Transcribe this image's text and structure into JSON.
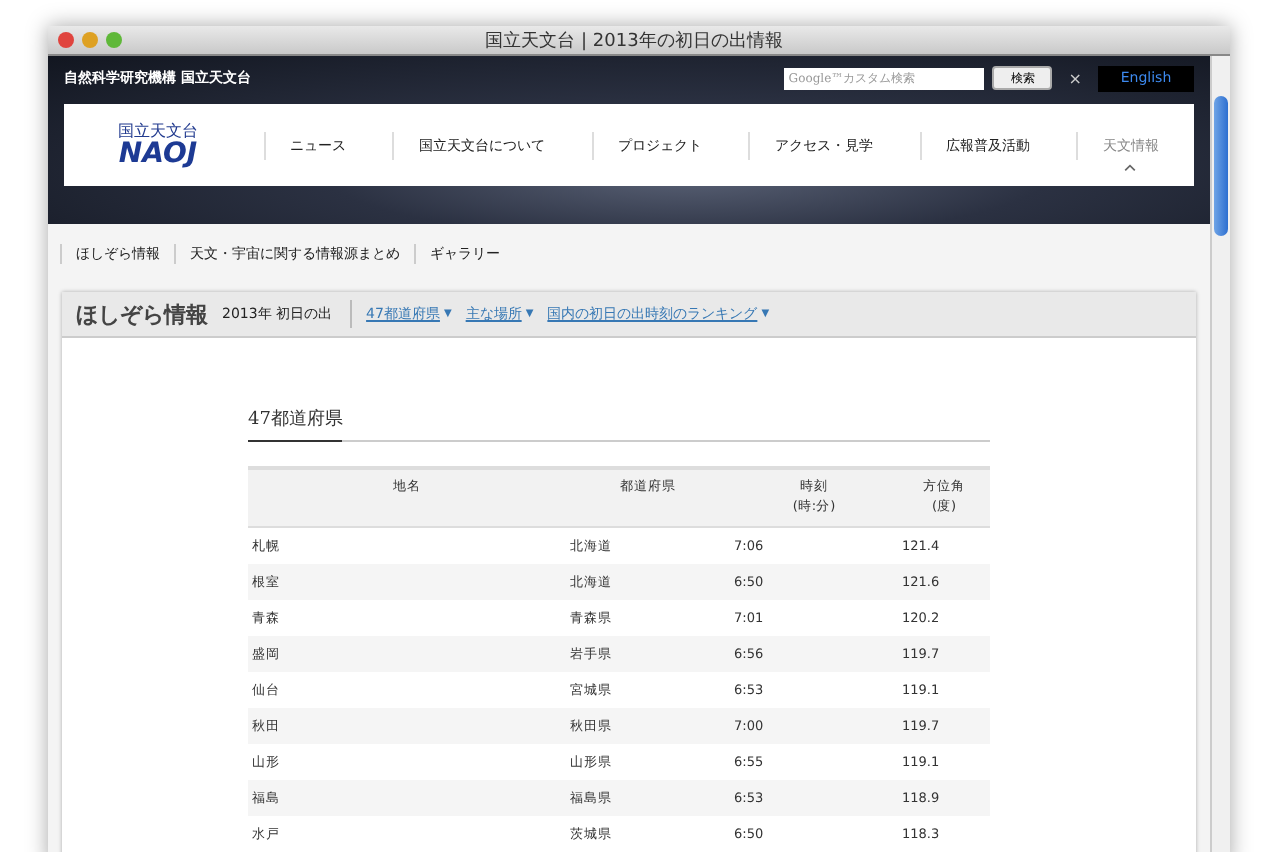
{
  "window": {
    "title": "国立天文台 | 2013年の初日の出情報"
  },
  "header": {
    "org": "自然科学研究機構 国立天文台",
    "search_placeholder": "カスタム検索",
    "search_brand": "Google™",
    "search_button": "検索",
    "clear": "×",
    "english": "English"
  },
  "logo": {
    "caption": "国立天文台",
    "text": "NAOJ"
  },
  "nav": [
    {
      "label": "ニュース",
      "selected": false
    },
    {
      "label": "国立天文台について",
      "selected": false
    },
    {
      "label": "プロジェクト",
      "selected": false
    },
    {
      "label": "アクセス・見学",
      "selected": false
    },
    {
      "label": "広報普及活動",
      "selected": false
    },
    {
      "label": "天文情報",
      "selected": true
    }
  ],
  "subnav": [
    "ほしぞら情報",
    "天文・宇宙に関する情報源まとめ",
    "ギャラリー"
  ],
  "section": {
    "title": "ほしぞら情報",
    "subtitle": "2013年 初日の出",
    "links": [
      "47都道府県",
      "主な場所",
      "国内の初日の出時刻のランキング"
    ],
    "caret": "▼"
  },
  "content": {
    "heading": "47都道府県",
    "table": {
      "columns": [
        "地名",
        "都道府県",
        "時刻\n(時:分)",
        "方位角\n(度)"
      ],
      "rows": [
        [
          "札幌",
          "北海道",
          "7:06",
          "121.4"
        ],
        [
          "根室",
          "北海道",
          "6:50",
          "121.6"
        ],
        [
          "青森",
          "青森県",
          "7:01",
          "120.2"
        ],
        [
          "盛岡",
          "岩手県",
          "6:56",
          "119.7"
        ],
        [
          "仙台",
          "宮城県",
          "6:53",
          "119.1"
        ],
        [
          "秋田",
          "秋田県",
          "7:00",
          "119.7"
        ],
        [
          "山形",
          "山形県",
          "6:55",
          "119.1"
        ],
        [
          "福島",
          "福島県",
          "6:53",
          "118.9"
        ],
        [
          "水戸",
          "茨城県",
          "6:50",
          "118.3"
        ]
      ]
    }
  }
}
